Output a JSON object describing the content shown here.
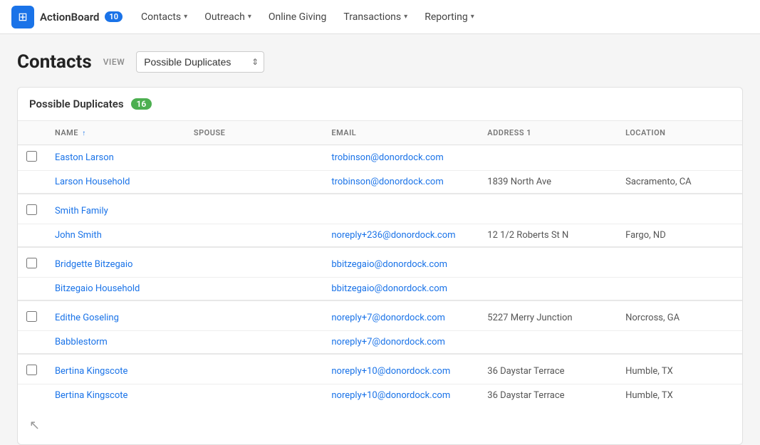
{
  "navbar": {
    "brand": {
      "icon": "⊞",
      "title": "ActionBoard",
      "badge": "10"
    },
    "items": [
      {
        "label": "Contacts",
        "hasDropdown": true
      },
      {
        "label": "Outreach",
        "hasDropdown": true
      },
      {
        "label": "Online Giving",
        "hasDropdown": false
      },
      {
        "label": "Transactions",
        "hasDropdown": true
      },
      {
        "label": "Reporting",
        "hasDropdown": true
      }
    ]
  },
  "page": {
    "title": "Contacts",
    "view_label": "VIEW",
    "view_selected": "Possible Duplicates"
  },
  "table": {
    "section_title": "Possible Duplicates",
    "count": "16",
    "columns": {
      "name": "NAME",
      "spouse": "SPOUSE",
      "email": "EMAIL",
      "address1": "ADDRESS 1",
      "location": "LOCATION"
    },
    "groups": [
      {
        "rows": [
          {
            "name": "Easton Larson",
            "spouse": "",
            "email": "trobinson@donordock.com",
            "address1": "",
            "location": ""
          },
          {
            "name": "Larson Household",
            "spouse": "",
            "email": "trobinson@donordock.com",
            "address1": "1839 North Ave",
            "location": "Sacramento, CA"
          }
        ]
      },
      {
        "rows": [
          {
            "name": "Smith Family",
            "spouse": "",
            "email": "",
            "address1": "",
            "location": ""
          },
          {
            "name": "John Smith",
            "spouse": "",
            "email": "noreply+236@donordock.com",
            "address1": "12 1/2 Roberts St N",
            "location": "Fargo, ND"
          }
        ]
      },
      {
        "rows": [
          {
            "name": "Bridgette Bitzegaio",
            "spouse": "",
            "email": "bbitzegaio@donordock.com",
            "address1": "",
            "location": ""
          },
          {
            "name": "Bitzegaio Household",
            "spouse": "",
            "email": "bbitzegaio@donordock.com",
            "address1": "",
            "location": ""
          }
        ]
      },
      {
        "rows": [
          {
            "name": "Edithe Goseling",
            "spouse": "",
            "email": "noreply+7@donordock.com",
            "address1": "5227 Merry Junction",
            "location": "Norcross, GA"
          },
          {
            "name": "Babblestorm",
            "spouse": "",
            "email": "noreply+7@donordock.com",
            "address1": "",
            "location": ""
          }
        ]
      },
      {
        "rows": [
          {
            "name": "Bertina Kingscote",
            "spouse": "",
            "email": "noreply+10@donordock.com",
            "address1": "36 Daystar Terrace",
            "location": "Humble, TX"
          },
          {
            "name": "Bertina Kingscote",
            "spouse": "",
            "email": "noreply+10@donordock.com",
            "address1": "36 Daystar Terrace",
            "location": "Humble, TX"
          }
        ]
      }
    ]
  }
}
